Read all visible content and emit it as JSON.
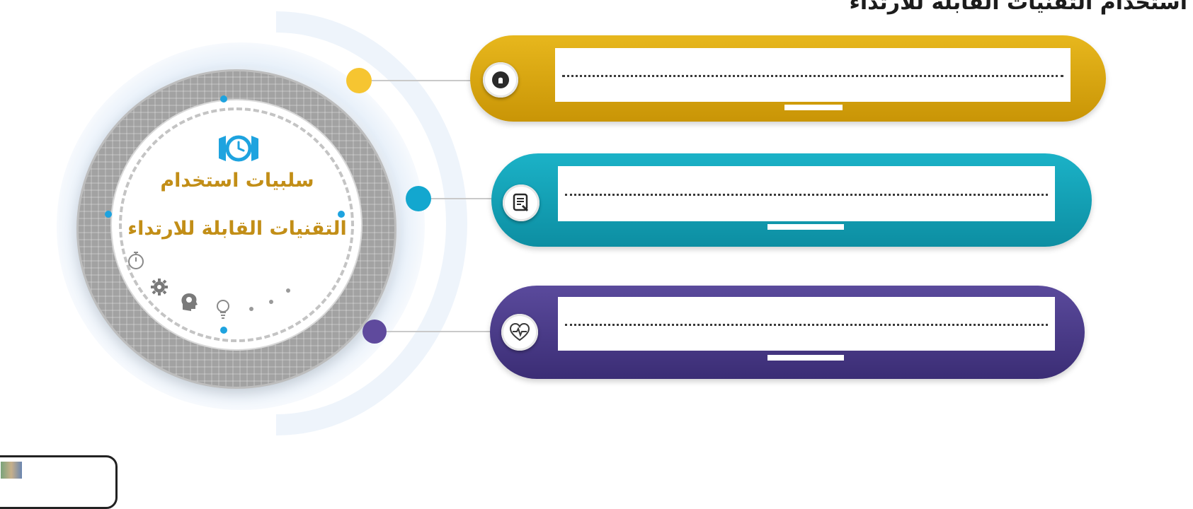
{
  "heading": "استخدام التقنيات القابلة للارتداء",
  "hub": {
    "title_line1": "سلبيات استخدام",
    "title_line2": "التقنيات القابلة للارتداء",
    "icon": "smartwatch-icon",
    "decor_icons": [
      "stopwatch-icon",
      "gear-icon",
      "head-gear-icon",
      "lightbulb-icon"
    ],
    "colors": {
      "ring": "#a2a2a2",
      "title": "#c28e17",
      "node": "#1ea3df"
    }
  },
  "rows": [
    {
      "id": "row-1",
      "color": "#d9a70c",
      "dot_color": "#f6c531",
      "icon": "mouse-icon",
      "answer": ""
    },
    {
      "id": "row-2",
      "color": "#119bb0",
      "dot_color": "#13a7cf",
      "icon": "document-icon",
      "answer": ""
    },
    {
      "id": "row-3",
      "color": "#4a3a8c",
      "dot_color": "#5f4a9d",
      "icon": "heartbeat-icon",
      "answer": ""
    }
  ]
}
